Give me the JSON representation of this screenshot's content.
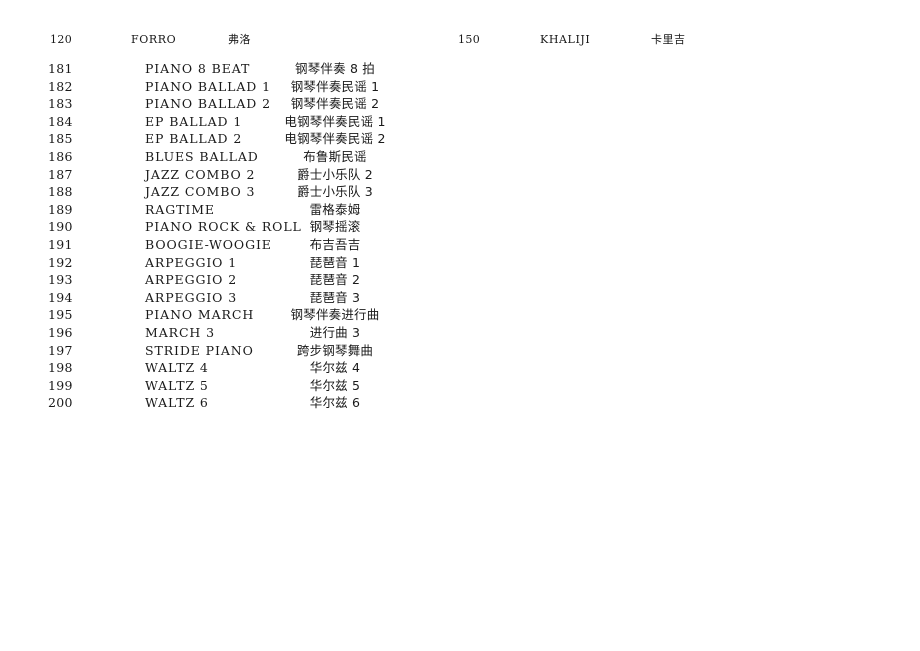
{
  "document": {
    "page_background": "#ffffff",
    "text_color": "#1a1a1a"
  },
  "continuation_row": {
    "left_entry": {
      "number": "120",
      "name_en": "FORRO",
      "name_zh": "弗洛"
    },
    "right_entry": {
      "number": "150",
      "name_en": "KHALIJI",
      "name_zh": "卡里吉"
    }
  },
  "table": {
    "rows": [
      {
        "number": "181",
        "name_en": "PIANO 8 BEAT",
        "name_zh": "钢琴伴奏 8 拍"
      },
      {
        "number": "182",
        "name_en": "PIANO BALLAD 1",
        "name_zh": "钢琴伴奏民谣 1"
      },
      {
        "number": "183",
        "name_en": "PIANO BALLAD 2",
        "name_zh": "钢琴伴奏民谣 2"
      },
      {
        "number": "184",
        "name_en": "EP BALLAD 1",
        "name_zh": "电钢琴伴奏民谣 1"
      },
      {
        "number": "185",
        "name_en": "EP BALLAD 2",
        "name_zh": "电钢琴伴奏民谣 2"
      },
      {
        "number": "186",
        "name_en": "BLUES BALLAD",
        "name_zh": "布鲁斯民谣"
      },
      {
        "number": "187",
        "name_en": "JAZZ COMBO 2",
        "name_zh": "爵士小乐队 2"
      },
      {
        "number": "188",
        "name_en": "JAZZ COMBO 3",
        "name_zh": "爵士小乐队 3"
      },
      {
        "number": "189",
        "name_en": "RAGTIME",
        "name_zh": "雷格泰姆"
      },
      {
        "number": "190",
        "name_en": "PIANO ROCK & ROLL",
        "name_zh": "钢琴摇滚"
      },
      {
        "number": "191",
        "name_en": "BOOGIE-WOOGIE",
        "name_zh": "布吉吾吉"
      },
      {
        "number": "192",
        "name_en": "ARPEGGIO 1",
        "name_zh": "琵琶音 1"
      },
      {
        "number": "193",
        "name_en": "ARPEGGIO 2",
        "name_zh": "琵琶音 2"
      },
      {
        "number": "194",
        "name_en": "ARPEGGIO 3",
        "name_zh": "琵琶音 3"
      },
      {
        "number": "195",
        "name_en": "PIANO MARCH",
        "name_zh": "钢琴伴奏进行曲"
      },
      {
        "number": "196",
        "name_en": "MARCH 3",
        "name_zh": "进行曲 3"
      },
      {
        "number": "197",
        "name_en": "STRIDE PIANO",
        "name_zh": "跨步钢琴舞曲"
      },
      {
        "number": "198",
        "name_en": "WALTZ 4",
        "name_zh": "华尔兹 4"
      },
      {
        "number": "199",
        "name_en": "WALTZ 5",
        "name_zh": "华尔兹 5"
      },
      {
        "number": "200",
        "name_en": "WALTZ 6",
        "name_zh": "华尔兹 6"
      }
    ]
  }
}
